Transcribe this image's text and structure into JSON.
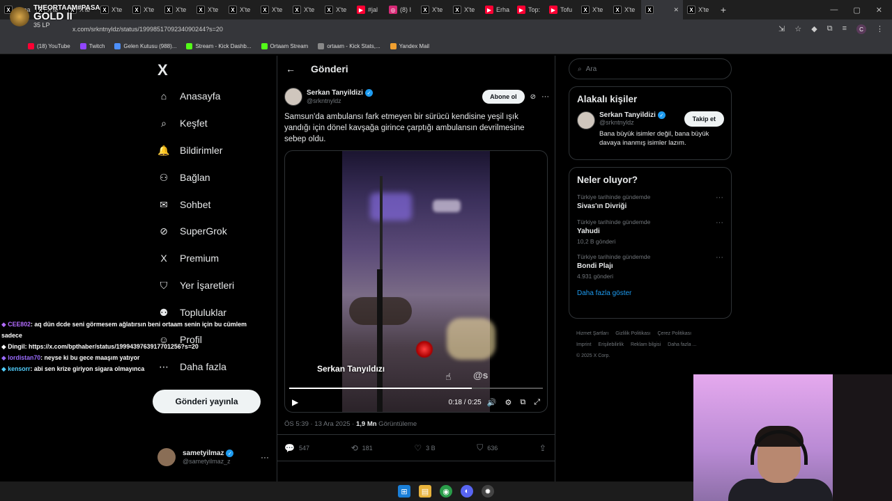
{
  "browser": {
    "tabs": [
      {
        "label": "Strea",
        "icon": "x",
        "color": "#ff5a5a"
      },
      {
        "label": "X'te",
        "icon": "x"
      },
      {
        "label": "X'te",
        "icon": "x"
      },
      {
        "label": "X'te",
        "icon": "x"
      },
      {
        "label": "X'te",
        "icon": "x"
      },
      {
        "label": "X'te",
        "icon": "x"
      },
      {
        "label": "X'te",
        "icon": "x"
      },
      {
        "label": "X'te",
        "icon": "x"
      },
      {
        "label": "X'te",
        "icon": "x"
      },
      {
        "label": "X'te",
        "icon": "x"
      },
      {
        "label": "X'te",
        "icon": "x"
      },
      {
        "label": "#jal",
        "icon": "yt"
      },
      {
        "label": "(8) I",
        "icon": "ig"
      },
      {
        "label": "X'te",
        "icon": "x"
      },
      {
        "label": "X'te",
        "icon": "x"
      },
      {
        "label": "Erha",
        "icon": "yt"
      },
      {
        "label": "Top:",
        "icon": "yt"
      },
      {
        "label": "Tofu",
        "icon": "yt"
      },
      {
        "label": "X'te",
        "icon": "x"
      },
      {
        "label": "X'te",
        "icon": "x"
      },
      {
        "label": "",
        "icon": "x",
        "active": true
      },
      {
        "label": "X'te",
        "icon": "x"
      }
    ],
    "new_tab": "+",
    "url": "x.com/srkntnyldz/status/1999851709234090244?s=20",
    "bookmarks": [
      {
        "label": "(18) YouTube",
        "color": "#ff0033"
      },
      {
        "label": "Twitch",
        "color": "#9146ff"
      },
      {
        "label": "Gelen Kutusu (988)...",
        "color": "#4d90fe"
      },
      {
        "label": "Stream - Kick Dashb...",
        "color": "#53fc18"
      },
      {
        "label": "Ortaam Stream",
        "color": "#53fc18"
      },
      {
        "label": "ortaam - Kick Stats,...",
        "color": "#888888"
      },
      {
        "label": "Yandex Mail",
        "color": "#f0a030"
      }
    ]
  },
  "stream_overlay": {
    "name": "THEORTAAM#PASA",
    "rank": "GOLD II",
    "lp": "35 LP"
  },
  "x": {
    "logo": "X",
    "nav": [
      {
        "label": "Anasayfa",
        "icon": "home-icon"
      },
      {
        "label": "Keşfet",
        "icon": "search-icon"
      },
      {
        "label": "Bildirimler",
        "icon": "bell-icon"
      },
      {
        "label": "Bağlan",
        "icon": "add-person-icon"
      },
      {
        "label": "Sohbet",
        "icon": "mail-icon"
      },
      {
        "label": "SuperGrok",
        "icon": "grok-icon"
      },
      {
        "label": "Premium",
        "icon": "x-icon"
      },
      {
        "label": "Yer İşaretleri",
        "icon": "bookmark-icon"
      },
      {
        "label": "Topluluklar",
        "icon": "people-icon"
      },
      {
        "label": "Profil",
        "icon": "person-icon"
      },
      {
        "label": "Daha fazla",
        "icon": "more-circle-icon"
      }
    ],
    "post_button": "Gönderi yayınla",
    "account": {
      "name": "sametyilmaz",
      "handle": "@sametyilmaz_z"
    }
  },
  "post": {
    "header_title": "Gönderi",
    "author": {
      "name": "Serkan Tanyildizi",
      "handle": "@srkntnyldz"
    },
    "subscribe": "Abone ol",
    "text": "Samsun'da ambulansı fark etmeyen bir sürücü kendisine yeşil ışık yandığı için dönel kavşağa girince çarptığı ambulansın devrilmesine sebep oldu.",
    "video": {
      "watermark": "Serkan Tanyıldızı",
      "watermark_at": "@s",
      "time": "0:18 / 0:25",
      "progress": 0.72
    },
    "meta": {
      "time": "ÖS 5:39 · 13 Ara 2025 · ",
      "views": "1,9 Mn",
      "views_label": " Görüntüleme"
    },
    "actions": {
      "replies": "547",
      "reposts": "181",
      "likes": "3 B",
      "bookmarks": "636"
    }
  },
  "sidebar": {
    "search_placeholder": "Ara",
    "related": {
      "title": "Alakalı kişiler",
      "name": "Serkan Tanyildizi",
      "handle": "@srkntnyldz",
      "follow": "Takip et",
      "bio": "Bana büyük isimler değil, bana büyük davaya inanmış isimler lazım."
    },
    "trends": {
      "title": "Neler oluyor?",
      "items": [
        {
          "context": "Türkiye tarihinde gündemde",
          "name": "Sivas'ın Divriği",
          "count": ""
        },
        {
          "context": "Türkiye tarihinde gündemde",
          "name": "Yahudi",
          "count": "10,2 B gönderi"
        },
        {
          "context": "Türkiye tarihinde gündemde",
          "name": "Bondi Plajı",
          "count": "4.931 gönderi"
        }
      ],
      "show_more": "Daha fazla göster"
    },
    "footer": {
      "links": [
        "Hizmet Şartları",
        "Gizlilik Politikası",
        "Çerez Politikası",
        "Imprint",
        "Erişilebilirlik",
        "Reklam bilgisi",
        "Daha fazla ..."
      ],
      "copyright": "© 2025 X Corp."
    }
  },
  "chat": [
    {
      "user": "CEE802",
      "color": "#b36cff",
      "message": ": aq dün dcde seni görmesem ağlatırsın beni ortaam senin için bu cümlem sadece"
    },
    {
      "user": "Dingil",
      "color": "#ffffff",
      "message": ": https://x.com/bpthaber/status/1999439763917701256?s=20"
    },
    {
      "user": "lordistan70",
      "color": "#9b6cff",
      "message": ": neyse ki bu gece maaşım yatıyor"
    },
    {
      "user": "kensorr",
      "color": "#52d0ff",
      "message": ": abi sen krize giriyon sigara olmayınca"
    }
  ]
}
